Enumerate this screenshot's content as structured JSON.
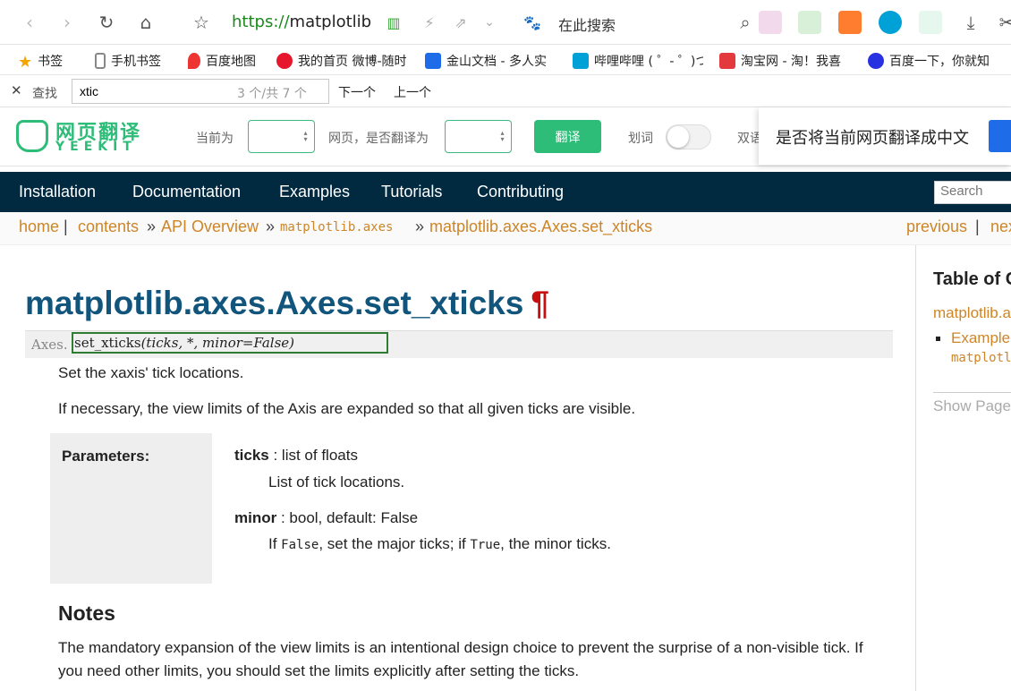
{
  "browser": {
    "url_scheme": "https://",
    "url_rest": "matplotlib",
    "search_placeholder": "在此搜索"
  },
  "bookmarks": [
    {
      "label": "书签"
    },
    {
      "label": "手机书签"
    },
    {
      "label": "百度地图"
    },
    {
      "label": "我的首页 微博-随时"
    },
    {
      "label": "金山文档 - 多人实"
    },
    {
      "label": "哔哩哔哩 ( ゜- ゜)つ"
    },
    {
      "label": "淘宝网 - 淘！我喜"
    },
    {
      "label": "百度一下，你就知"
    }
  ],
  "findbar": {
    "label": "查找",
    "query": "xtic",
    "count": "3 个/共 7 个",
    "next": "下一个",
    "prev": "上一个"
  },
  "yeekit": {
    "logo_cn": "网页翻译",
    "logo_en": "YEEKIT",
    "current_label": "当前为",
    "page_label": "网页，是否翻译为",
    "translate_button": "翻译",
    "word_label": "划词",
    "dual_label": "双语",
    "popup_text": "是否将当前网页翻译成中文"
  },
  "nav": {
    "items": [
      "Installation",
      "Documentation",
      "Examples",
      "Tutorials",
      "Contributing"
    ],
    "search_placeholder": "Search"
  },
  "breadcrumb": {
    "home": "home",
    "contents": "contents",
    "api": "API Overview",
    "module": "matplotlib.axes",
    "current": "matplotlib.axes.Axes.set_xticks",
    "previous": "previous",
    "next": "next"
  },
  "doc": {
    "title": "matplotlib.axes.Axes.set_xticks",
    "pilcrow": "¶",
    "sig_class": "Axes.",
    "sig_name": "set_xticks",
    "sig_args": "(ticks, *, minor=False)",
    "summary": "Set the xaxis' tick locations.",
    "desc": "If necessary, the view limits of the Axis are expanded so that all given ticks are visible.",
    "params_label": "Parameters:",
    "params": [
      {
        "name": "ticks",
        "type": " : list of floats",
        "desc": "List of tick locations."
      },
      {
        "name": "minor",
        "type": " : bool, default: False",
        "desc_pre": "If ",
        "code1": "False",
        "desc_mid": ", set the major ticks; if ",
        "code2": "True",
        "desc_post": ", the minor ticks."
      }
    ],
    "notes_heading": "Notes",
    "notes_line1": "The mandatory expansion of the view limits is an intentional design choice to prevent the surprise of a non-visible tick. If",
    "notes_line2": "you need other limits, you should set the limits explicitly after setting the ticks."
  },
  "sidebar": {
    "toc_title": "Table of Contents",
    "link1": "matplotlib.axes.Axes.set_xticks",
    "link2": "Examples using",
    "link3": "matplotlib.axes.Axes.set_xticks",
    "show_page": "Show Page Source"
  },
  "colors": {
    "accent_green": "#2dbd78",
    "nav_bg": "#012a41",
    "link": "#ce8527",
    "title": "#11557c"
  }
}
